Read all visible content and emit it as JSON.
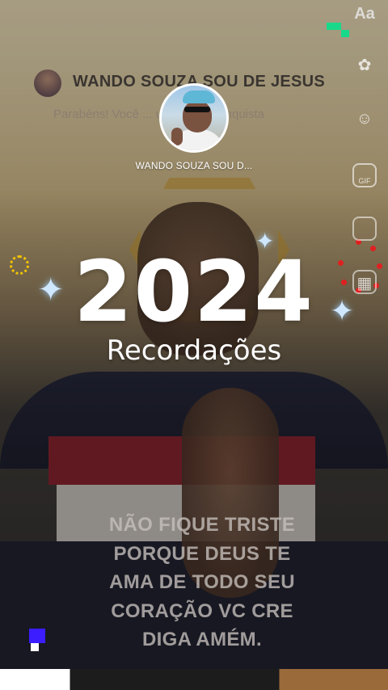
{
  "card": {
    "name": "WANDO SOUZA  SOU DE JESUS",
    "subtitle": "Parabéns! Você ... uma nova conquista"
  },
  "profile": {
    "name": "WANDO SOUZA  SOU D..."
  },
  "memory": {
    "year": "2024",
    "title": "Recordações"
  },
  "caption_lines": [
    "NÃO FIQUE TRISTE",
    "PORQUE DEUS TE",
    "AMA DE TODO SEU",
    "CORAÇÃO VC CRE",
    "DIGA AMÉM."
  ],
  "toolbar": {
    "text_label": "Aa",
    "gif_label": "GIF",
    "icons": [
      "text-icon",
      "sticker-icon",
      "emoji-icon",
      "gif-icon",
      "layers-icon",
      "collage-icon"
    ]
  },
  "colors": {
    "accent_yellow": "#f2c400",
    "confetti_red": "#e02020",
    "pixel_green": "#18d98a",
    "pixel_blue": "#3b1dff"
  }
}
